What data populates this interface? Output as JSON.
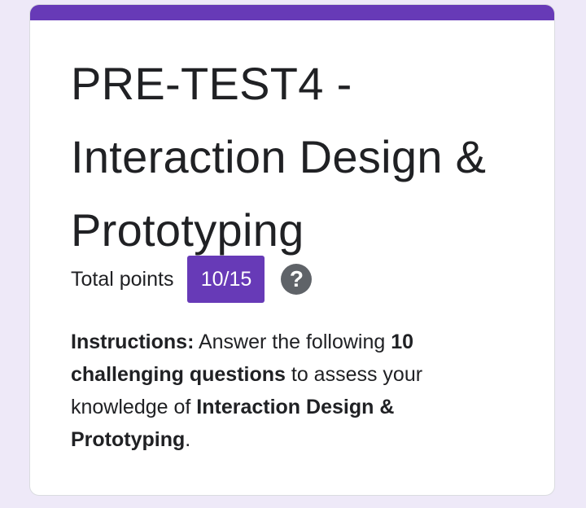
{
  "colors": {
    "accent": "#673ab7",
    "background": "#eee9f8",
    "card": "#ffffff",
    "text": "#202124",
    "help_icon": "#5f6368"
  },
  "form": {
    "title": "PRE-TEST4 - Interaction Design & Prototyping",
    "points_label": "Total points",
    "score": "10/15",
    "help_icon_name": "help-circle-icon",
    "help_glyph": "?",
    "instructions": {
      "label": "Instructions:",
      "text1": " Answer the following ",
      "bold1": "10 challenging questions",
      "text2": " to assess your knowledge of ",
      "bold2": "Interaction Design & Prototyping",
      "text3": "."
    }
  }
}
